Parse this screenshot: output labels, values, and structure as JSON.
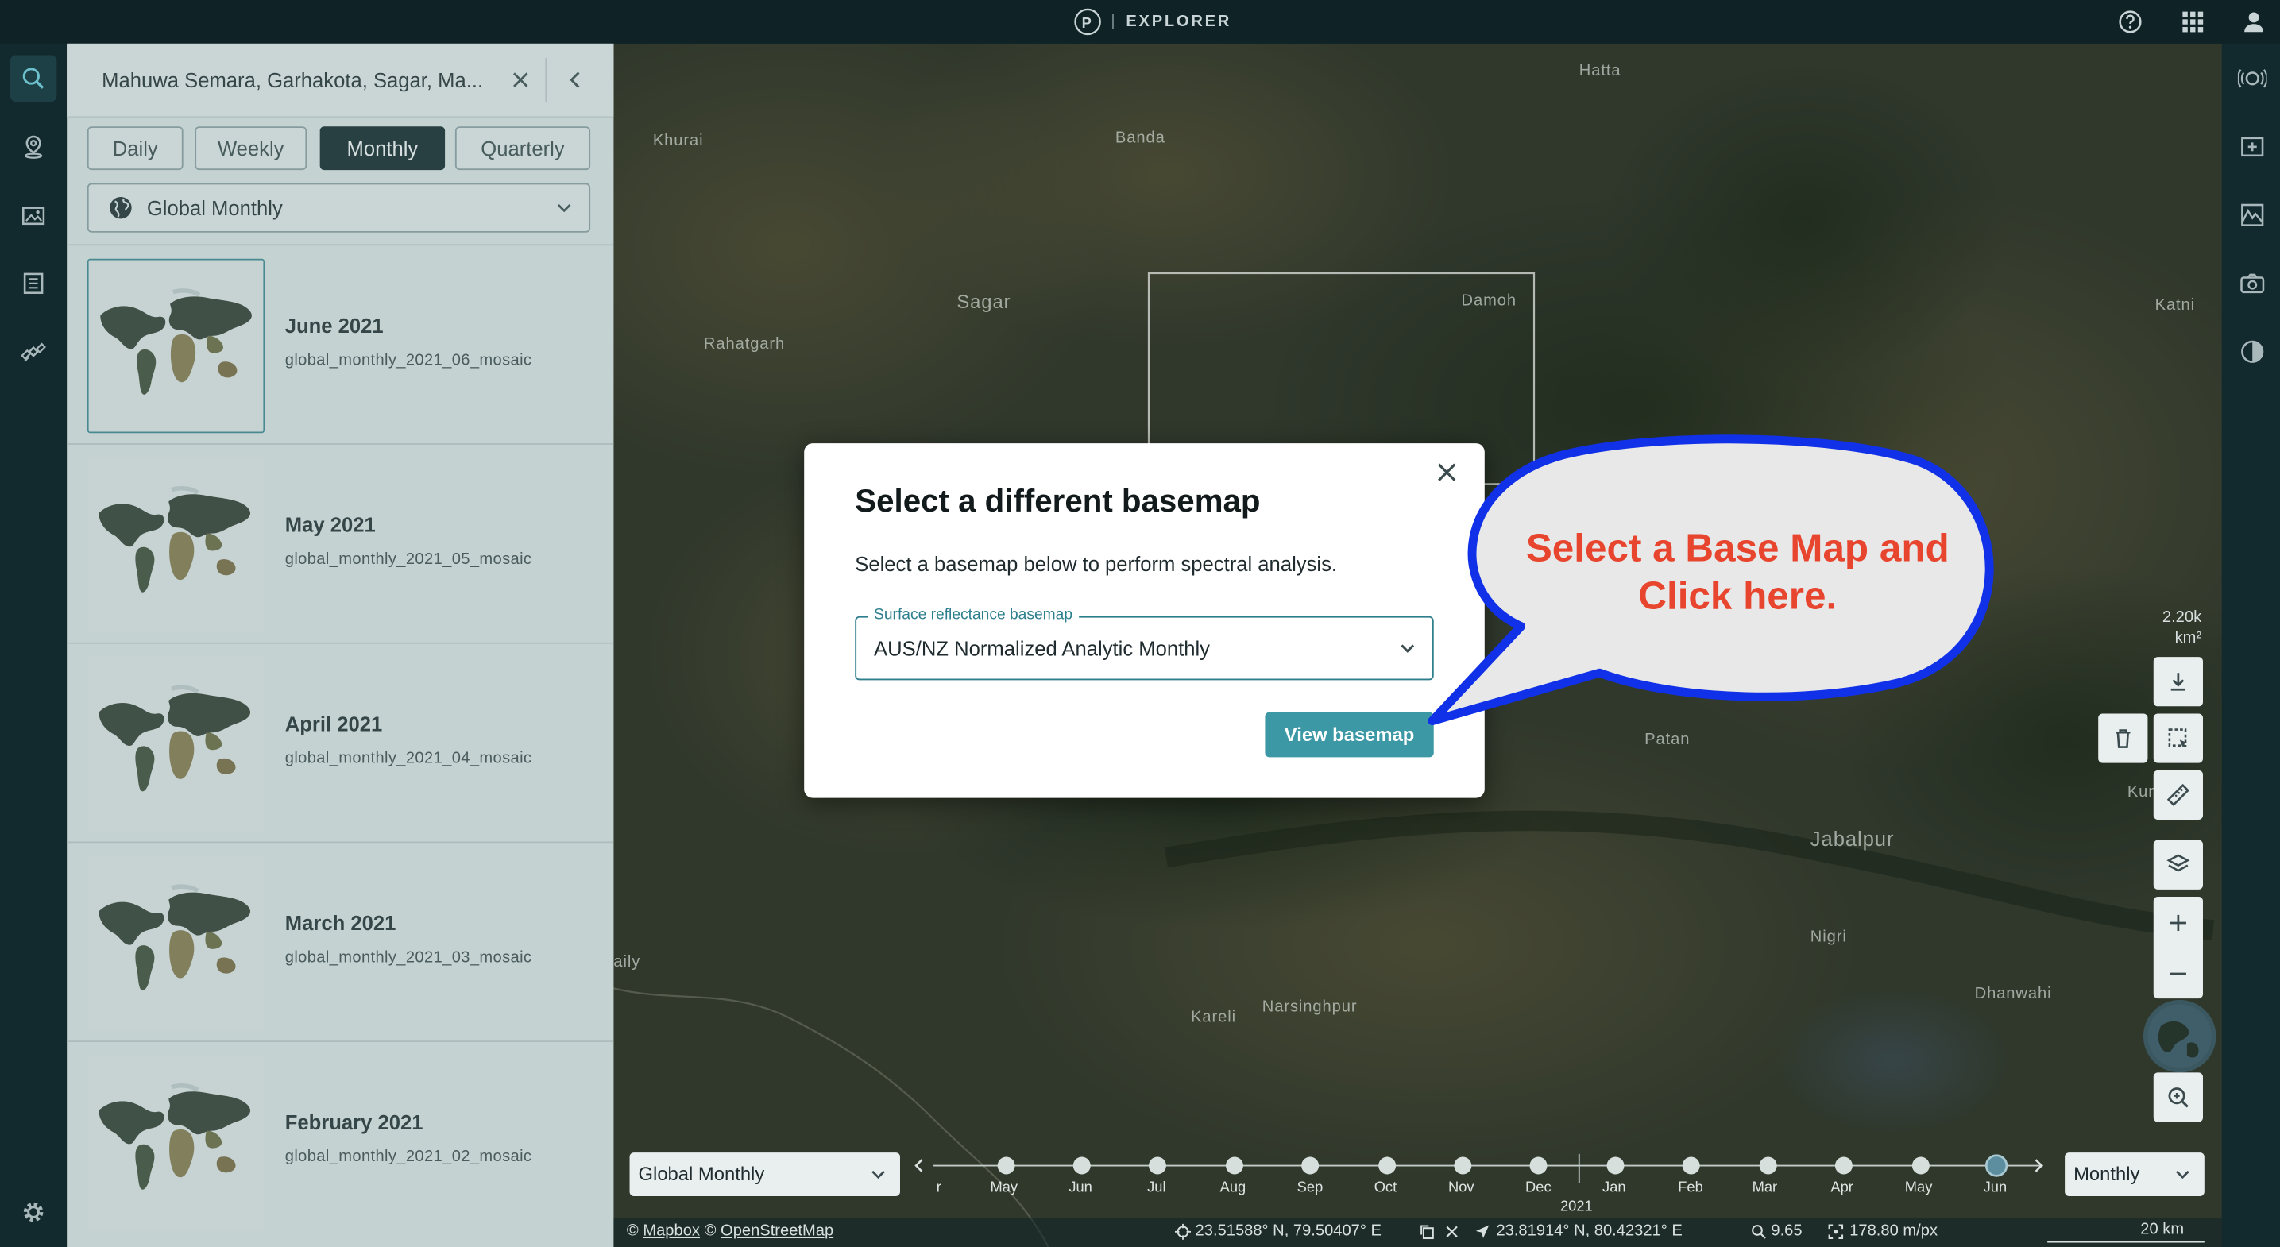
{
  "app": {
    "brand_letter": "P",
    "title": "EXPLORER"
  },
  "panel": {
    "location": "Mahuwa Semara, Garhakota, Sagar, Ma...",
    "tabs": [
      {
        "label": "Daily",
        "active": false
      },
      {
        "label": "Weekly",
        "active": false
      },
      {
        "label": "Monthly",
        "active": true
      },
      {
        "label": "Quarterly",
        "active": false
      }
    ],
    "mosaic_type": "Global Monthly",
    "items": [
      {
        "title": "June 2021",
        "subtitle": "global_monthly_2021_06_mosaic",
        "selected": true
      },
      {
        "title": "May 2021",
        "subtitle": "global_monthly_2021_05_mosaic",
        "selected": false
      },
      {
        "title": "April 2021",
        "subtitle": "global_monthly_2021_04_mosaic",
        "selected": false
      },
      {
        "title": "March 2021",
        "subtitle": "global_monthly_2021_03_mosaic",
        "selected": false
      },
      {
        "title": "February 2021",
        "subtitle": "global_monthly_2021_02_mosaic",
        "selected": false
      }
    ]
  },
  "map": {
    "places": [
      "Hatta",
      "Khurai",
      "Banda",
      "Sagar",
      "Damoh",
      "Rahatgarh",
      "Katni",
      "Patan",
      "Kund",
      "Jabalpur",
      "Nigri",
      "Dhanwahi",
      "Kareli",
      "Narsinghpur",
      "aily"
    ],
    "area_value": "2.20k",
    "area_unit": "km²"
  },
  "modal": {
    "title": "Select a different basemap",
    "description": "Select a basemap below to perform spectral analysis.",
    "field_label": "Surface reflectance basemap",
    "field_value": "AUS/NZ Normalized Analytic Monthly",
    "button": "View basemap"
  },
  "callout": {
    "line1": "Select a Base Map and",
    "line2": "Click here."
  },
  "timeline": {
    "selector": "Global Monthly",
    "interval": "Monthly",
    "months": [
      "r",
      "May",
      "Jun",
      "Jul",
      "Aug",
      "Sep",
      "Oct",
      "Nov",
      "Dec",
      "Jan",
      "Feb",
      "Mar",
      "Apr",
      "May",
      "Jun"
    ],
    "year": "2021"
  },
  "footer": {
    "mapbox": "Mapbox",
    "osm": "OpenStreetMap",
    "copyright_symbol": "©",
    "coord1": "23.51588° N, 79.50407° E",
    "coord2": "23.81914° N, 80.42321° E",
    "zoom": "9.65",
    "resolution": "178.80 m/px",
    "scale": "20 km"
  },
  "colors": {
    "accent": "#3d98a6",
    "topbar": "#0f2327",
    "callout_text": "#e8452f",
    "callout_border": "#1131e8"
  }
}
